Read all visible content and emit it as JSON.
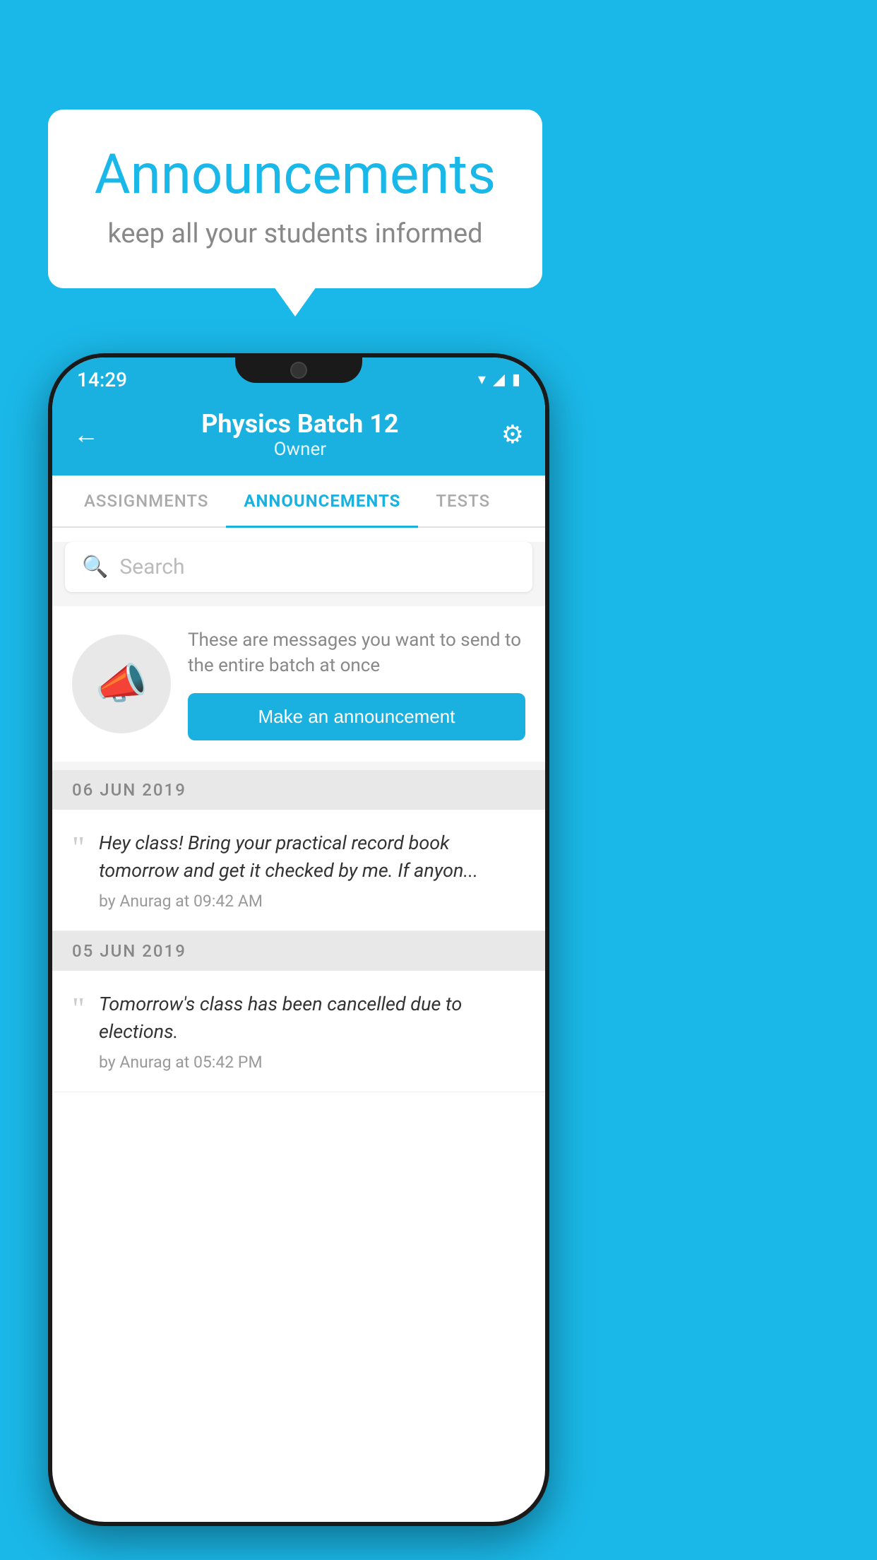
{
  "background_color": "#1ab8e8",
  "speech_bubble": {
    "title": "Announcements",
    "subtitle": "keep all your students informed"
  },
  "phone": {
    "status_bar": {
      "time": "14:29",
      "wifi": "▾",
      "signal": "▲",
      "battery": "▮"
    },
    "header": {
      "back_label": "←",
      "title": "Physics Batch 12",
      "subtitle": "Owner",
      "gear_label": "⚙"
    },
    "tabs": [
      {
        "label": "ASSIGNMENTS",
        "active": false
      },
      {
        "label": "ANNOUNCEMENTS",
        "active": true
      },
      {
        "label": "TESTS",
        "active": false
      }
    ],
    "search": {
      "placeholder": "Search"
    },
    "announcement_prompt": {
      "description": "These are messages you want to send to the entire batch at once",
      "button_label": "Make an announcement"
    },
    "announcements": [
      {
        "date": "06  JUN  2019",
        "text": "Hey class! Bring your practical record book tomorrow and get it checked by me. If anyon...",
        "meta": "by Anurag at 09:42 AM"
      },
      {
        "date": "05  JUN  2019",
        "text": "Tomorrow's class has been cancelled due to elections.",
        "meta": "by Anurag at 05:42 PM"
      }
    ]
  }
}
